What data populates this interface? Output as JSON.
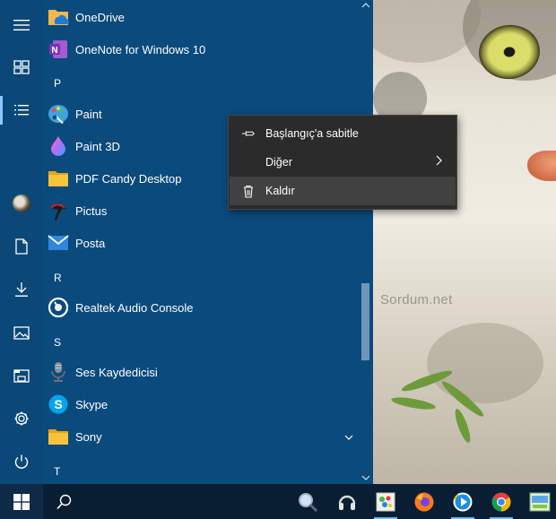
{
  "start_menu": {
    "apps": [
      {
        "label": "OneDrive",
        "icon": "onedrive-icon"
      },
      {
        "label": "OneNote for Windows 10",
        "icon": "onenote-icon"
      },
      {
        "label": "Paint",
        "icon": "paint-icon"
      },
      {
        "label": "Paint 3D",
        "icon": "paint3d-icon"
      },
      {
        "label": "PDF Candy Desktop",
        "icon": "folder-icon"
      },
      {
        "label": "Pictus",
        "icon": "pictus-icon"
      },
      {
        "label": "Posta",
        "icon": "mail-icon"
      },
      {
        "label": "Realtek Audio Console",
        "icon": "realtek-icon"
      },
      {
        "label": "Ses Kaydedicisi",
        "icon": "microphone-icon"
      },
      {
        "label": "Skype",
        "icon": "skype-icon"
      },
      {
        "label": "Sony",
        "icon": "folder-icon"
      }
    ],
    "letters": [
      "P",
      "R",
      "S",
      "T"
    ]
  },
  "rail": {
    "icons": [
      "hamburger-menu-icon",
      "tiles-icon",
      "all-apps-list-icon",
      "user-avatar",
      "documents-icon",
      "downloads-icon",
      "pictures-icon",
      "file-explorer-icon",
      "settings-icon",
      "power-icon"
    ]
  },
  "context_menu": {
    "items": [
      {
        "label": "Başlangıç'a sabitle",
        "icon": "pin-icon"
      },
      {
        "label": "Diğer",
        "icon": "",
        "submenu": true
      },
      {
        "label": "Kaldır",
        "icon": "trash-icon"
      }
    ]
  },
  "wallpaper": {
    "watermark": "Sordum.net"
  },
  "taskbar": {
    "icons": [
      "windows-start-icon",
      "search-icon",
      "magnifier-app-icon",
      "headset-app-icon",
      "photo-app-icon",
      "firefox-icon",
      "media-player-icon",
      "chrome-icon",
      "ftp-app-icon"
    ]
  },
  "colors": {
    "start_bg": "#0b4a7d",
    "context_menu_bg": "#2b2b2b",
    "context_hover": "#414141",
    "taskbar_bg": "#0a1e33"
  }
}
